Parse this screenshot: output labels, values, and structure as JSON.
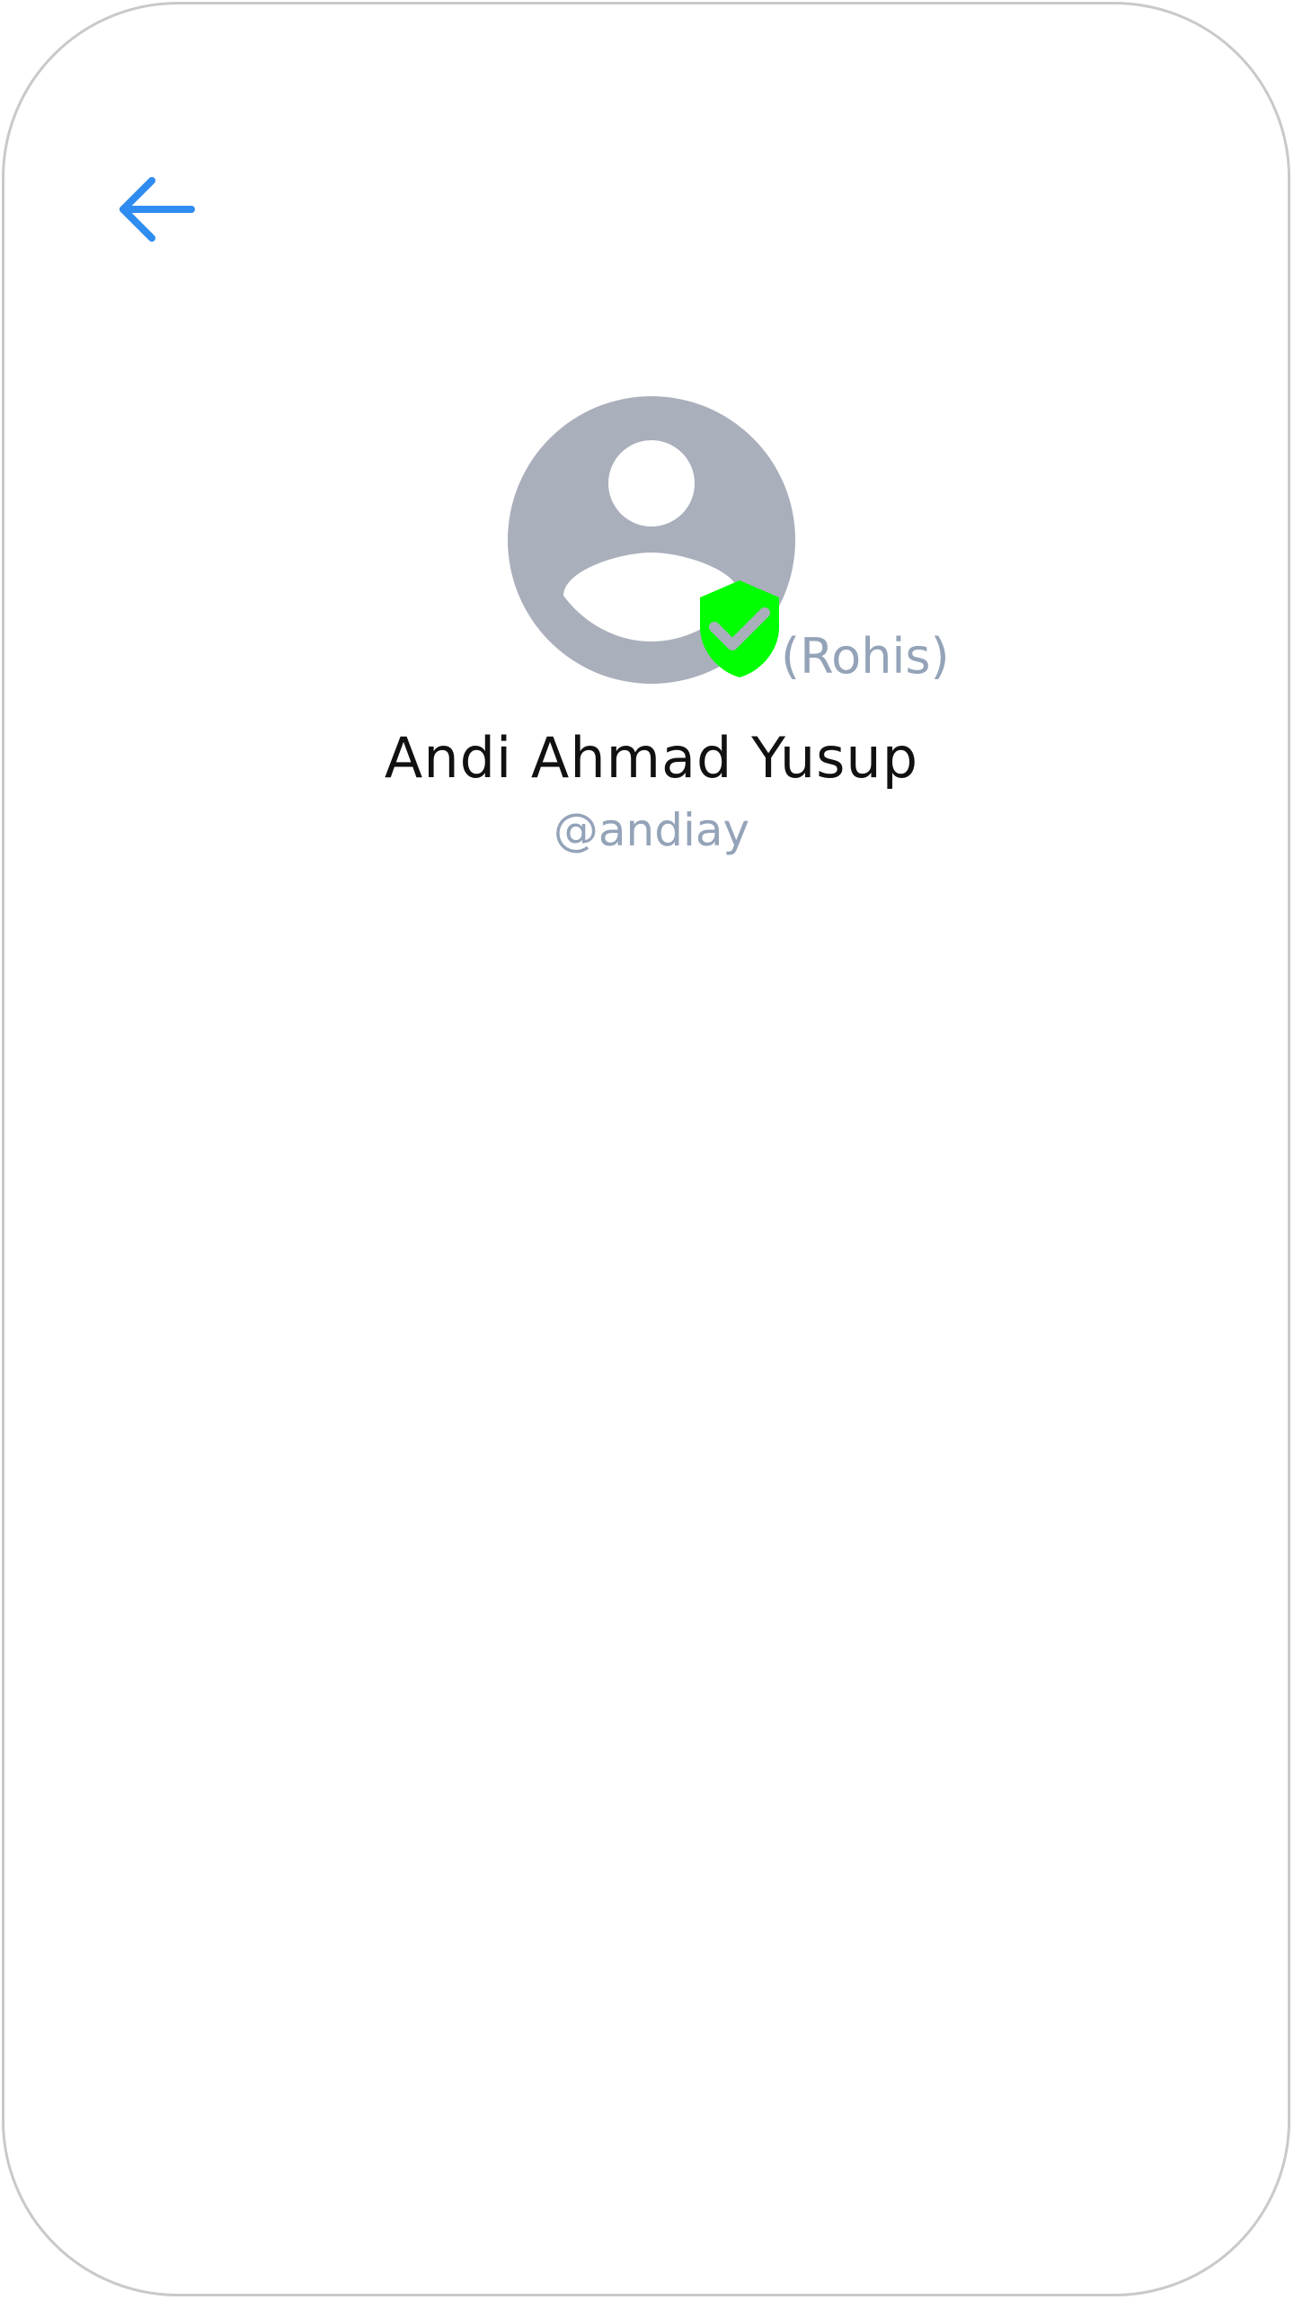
{
  "header": {
    "back_icon": "arrow-left-icon",
    "accent_color": "#2f8cf0"
  },
  "profile": {
    "avatar_icon": "user-avatar-placeholder-icon",
    "avatar_color": "#a9afbb",
    "badge_icon": "shield-check-icon",
    "badge_color": "#00ff00",
    "role": "(Rohis)",
    "name": "Andi Ahmad Yusup",
    "username": "@andiay",
    "muted_text_color": "#94a3b8"
  }
}
